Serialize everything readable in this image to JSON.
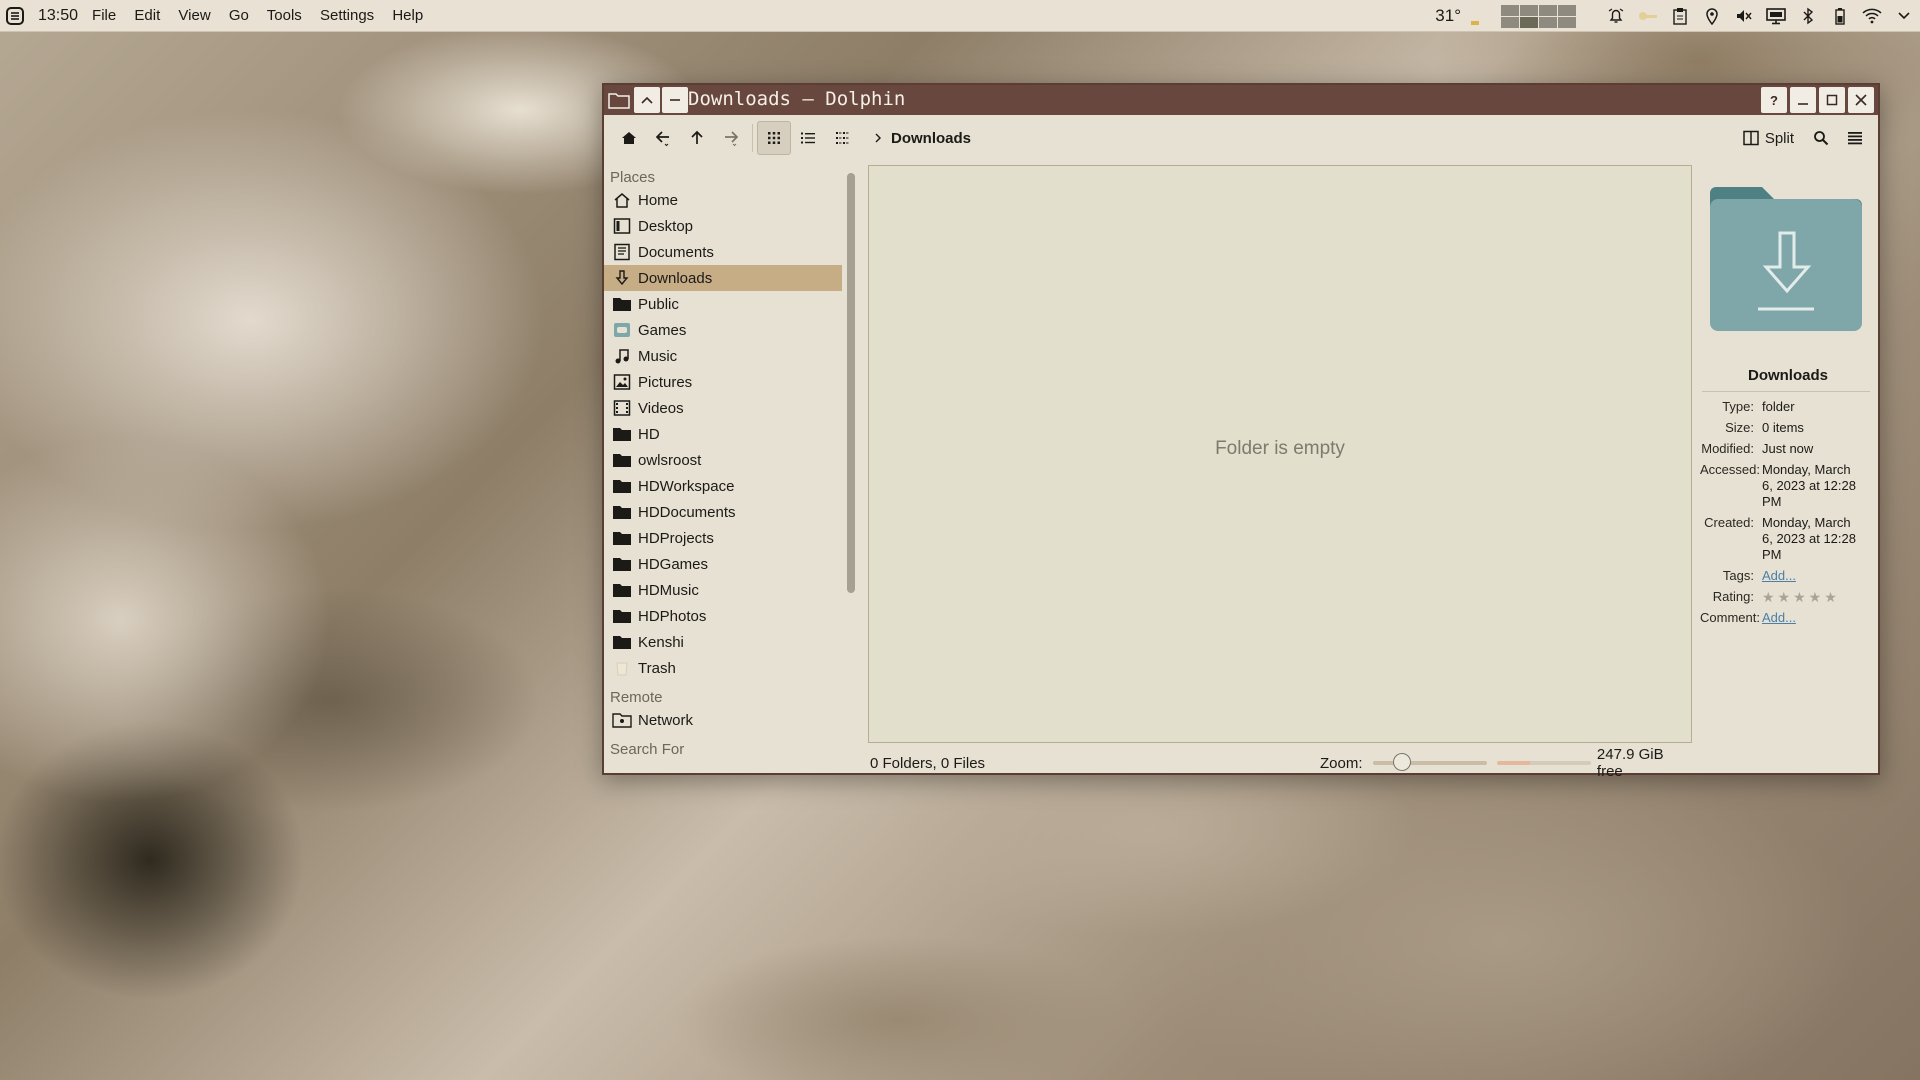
{
  "panel": {
    "clock": "13:50",
    "menu": [
      "File",
      "Edit",
      "View",
      "Go",
      "Tools",
      "Settings",
      "Help"
    ],
    "temperature": "31°",
    "tray_icons": [
      "alarm-icon",
      "key-icon",
      "clipboard-icon",
      "location-icon",
      "volume-muted-icon",
      "display-icon",
      "bluetooth-icon",
      "battery-icon",
      "wifi-icon",
      "expand-icon"
    ]
  },
  "window": {
    "title": "Downloads — Dolphin",
    "titlebar_buttons": [
      "help",
      "minimize",
      "maximize",
      "close"
    ]
  },
  "toolbar": {
    "breadcrumb": "Downloads",
    "split_label": "Split",
    "view_modes": [
      "icons",
      "details",
      "compact"
    ],
    "active_view": "icons"
  },
  "sidebar": {
    "places_header": "Places",
    "places": [
      {
        "label": "Home",
        "icon": "home-icon"
      },
      {
        "label": "Desktop",
        "icon": "desktop-icon"
      },
      {
        "label": "Documents",
        "icon": "documents-icon"
      },
      {
        "label": "Downloads",
        "icon": "downloads-icon",
        "selected": true
      },
      {
        "label": "Public",
        "icon": "folder-icon"
      },
      {
        "label": "Games",
        "icon": "games-icon"
      },
      {
        "label": "Music",
        "icon": "music-icon"
      },
      {
        "label": "Pictures",
        "icon": "pictures-icon"
      },
      {
        "label": "Videos",
        "icon": "videos-icon"
      },
      {
        "label": "HD",
        "icon": "folder-icon"
      },
      {
        "label": "owlsroost",
        "icon": "folder-icon"
      },
      {
        "label": "HDWorkspace",
        "icon": "folder-icon"
      },
      {
        "label": "HDDocuments",
        "icon": "folder-icon"
      },
      {
        "label": "HDProjects",
        "icon": "folder-icon"
      },
      {
        "label": "HDGames",
        "icon": "folder-icon"
      },
      {
        "label": "HDMusic",
        "icon": "folder-icon"
      },
      {
        "label": "HDPhotos",
        "icon": "folder-icon"
      },
      {
        "label": "Kenshi",
        "icon": "folder-icon"
      },
      {
        "label": "Trash",
        "icon": "trash-icon"
      }
    ],
    "remote_header": "Remote",
    "remote": [
      {
        "label": "Network",
        "icon": "network-icon"
      }
    ],
    "search_header": "Search For"
  },
  "main": {
    "empty_text": "Folder is empty"
  },
  "info_panel": {
    "name": "Downloads",
    "rows": [
      {
        "key": "Type:",
        "value": "folder"
      },
      {
        "key": "Size:",
        "value": "0 items"
      },
      {
        "key": "Modified:",
        "value": "Just now"
      },
      {
        "key": "Accessed:",
        "value": "Monday, March 6, 2023 at 12:28 PM"
      },
      {
        "key": "Created:",
        "value": "Monday, March 6, 2023 at 12:28 PM"
      }
    ],
    "tags_key": "Tags:",
    "tags_value": "Add...",
    "rating_key": "Rating:",
    "rating_stars": 0,
    "comment_key": "Comment:",
    "comment_value": "Add..."
  },
  "status": {
    "counts": "0 Folders, 0 Files",
    "zoom_label": "Zoom:",
    "zoom_level": 0.25,
    "free_space": "247.9 GiB free",
    "used_fraction": 0.35
  },
  "colors": {
    "titlebar": "#68483e",
    "selection": "#c7ad86",
    "folder_icon": "#7fa6a8",
    "link": "#4a7fa8"
  }
}
